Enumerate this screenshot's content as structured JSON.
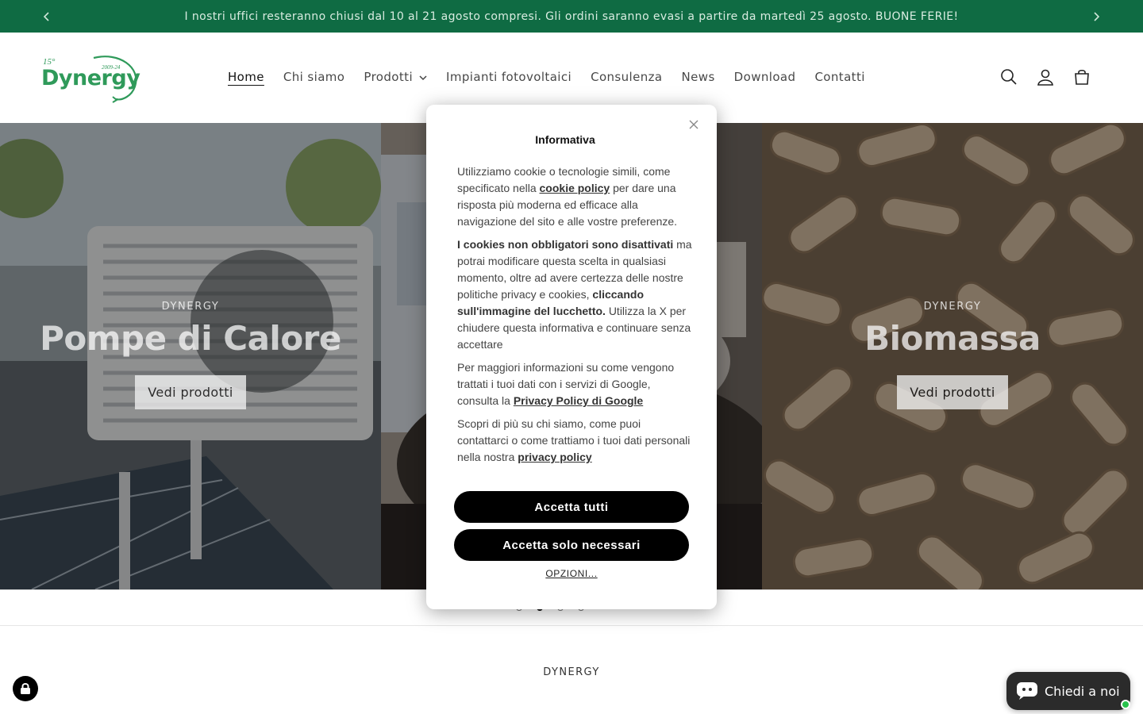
{
  "announcement": {
    "text": "I nostri uffici resteranno chiusi dal 10 al 21 agosto compresi. Gli ordini saranno evasi a partire da martedì 25 agosto. BUONE FERIE!",
    "prev_icon": "chevron-left-icon",
    "next_icon": "chevron-right-icon"
  },
  "header": {
    "logo_text": "Dynergy",
    "logo_badge": "15°",
    "logo_years": "2009-24",
    "nav": [
      {
        "label": "Home"
      },
      {
        "label": "Chi siamo"
      },
      {
        "label": "Prodotti"
      },
      {
        "label": "Impianti fotovoltaici"
      },
      {
        "label": "Consulenza"
      },
      {
        "label": "News"
      },
      {
        "label": "Download"
      },
      {
        "label": "Contatti"
      }
    ],
    "icons": [
      "search-icon",
      "account-icon",
      "cart-icon"
    ]
  },
  "hero": {
    "slides": [
      {
        "kicker": "DYNERGY",
        "title": "Pompe di Calore",
        "button": "Vedi prodotti"
      },
      {
        "kicker": "",
        "title": "",
        "button": ""
      },
      {
        "kicker": "DYNERGY",
        "title": "Biomassa",
        "button": "Vedi prodotti"
      }
    ],
    "dots_total": 4,
    "dot_active": 2
  },
  "section": {
    "kicker": "DYNERGY"
  },
  "chat": {
    "label": "Chiedi a noi"
  },
  "cookie_modal": {
    "title": "Informativa",
    "p1_before": "Utilizziamo cookie o tecnologie simili, come specificato nella",
    "p1_link": "cookie policy",
    "p1_after": "per dare una risposta più moderna ed efficace alla navigazione del sito e alle vostre preferenze.",
    "p2_bold": "I cookies non obbligatori sono disattivati",
    "p2_text": "ma potrai modificare questa scelta in qualsiasi momento, oltre ad avere certezza delle nostre politiche privacy e cookies,",
    "p2_bold2": "cliccando sull'immagine del lucchetto.",
    "p2_text2": "Utilizza la X per chiudere questa informativa e continuare senza accettare",
    "p3_before": "Per maggiori informazioni su come vengono trattati i tuoi dati con i servizi di Google, consulta la",
    "p3_link": "Privacy Policy di Google",
    "p4_before": "Scopri di più su chi siamo, come puoi contattarci o come trattiamo i tuoi dati personali nella nostra",
    "p4_link": "privacy policy",
    "accept_all": "Accetta tutti",
    "accept_necessary": "Accetta solo necessari",
    "options": "OPZIONI..."
  }
}
